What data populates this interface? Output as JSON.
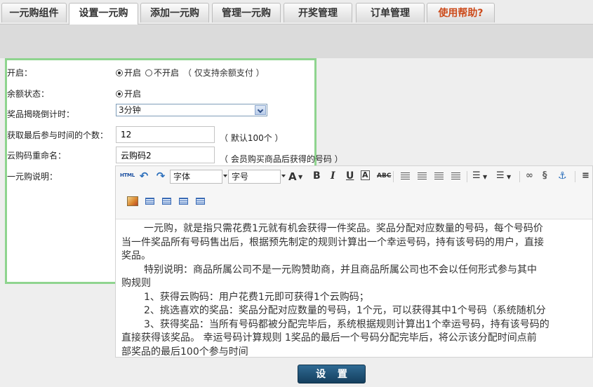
{
  "tabs": [
    {
      "label": "一元购组件"
    },
    {
      "label": "设置一元购"
    },
    {
      "label": "添加一元购"
    },
    {
      "label": "管理一元购"
    },
    {
      "label": "开奖管理"
    },
    {
      "label": "订单管理"
    },
    {
      "label": "使用帮助?"
    }
  ],
  "form": {
    "enable": {
      "label": "开启：",
      "on": "开启",
      "off": "不开启",
      "hint": "（ 仅支持余额支付 ）"
    },
    "balance": {
      "label": "余额状态：",
      "on": "开启"
    },
    "countdown": {
      "label": "奖品揭晓倒计时：",
      "value": "3分钟"
    },
    "recent": {
      "label": "获取最后参与时间的个数：",
      "value": "12",
      "hint": "（ 默认100个 ）"
    },
    "rename": {
      "label": "云购码重命名：",
      "value": "云购码2",
      "hint": "（ 会员购买商品后获得的号码 ）"
    },
    "desc": {
      "label": "一元购说明："
    }
  },
  "editor": {
    "html_label": "HTML",
    "font_family": "字体",
    "font_size": "字号",
    "lines": [
      "一元购，就是指只需花费1元就有机会获得一件奖品。奖品分配对应数量的号码，每个号码价",
      "当一件奖品所有号码售出后，根据预先制定的规则计算出一个幸运号码，持有该号码的用户，直接",
      "奖品。",
      "特别说明：商品所属公司不是一元购赞助商，并且商品所属公司也不会以任何形式参与其中",
      "购规则",
      "1、获得云购码：用户花费1元即可获得1个云购码；",
      "2、挑选喜欢的奖品：奖品分配对应数量的号码，1个元，可以获得其中1个号码（系统随机分",
      "3、获得奖品：当所有号码都被分配完毕后，系统根据规则计算出1个幸运号码，持有该号码的",
      "直接获得该奖品。 幸运号码计算规则 1奖品的最后一个号码分配完毕后，将公示该分配时间点前",
      "部奖品的最后100个参与时间"
    ]
  },
  "submit_label": "设 置"
}
